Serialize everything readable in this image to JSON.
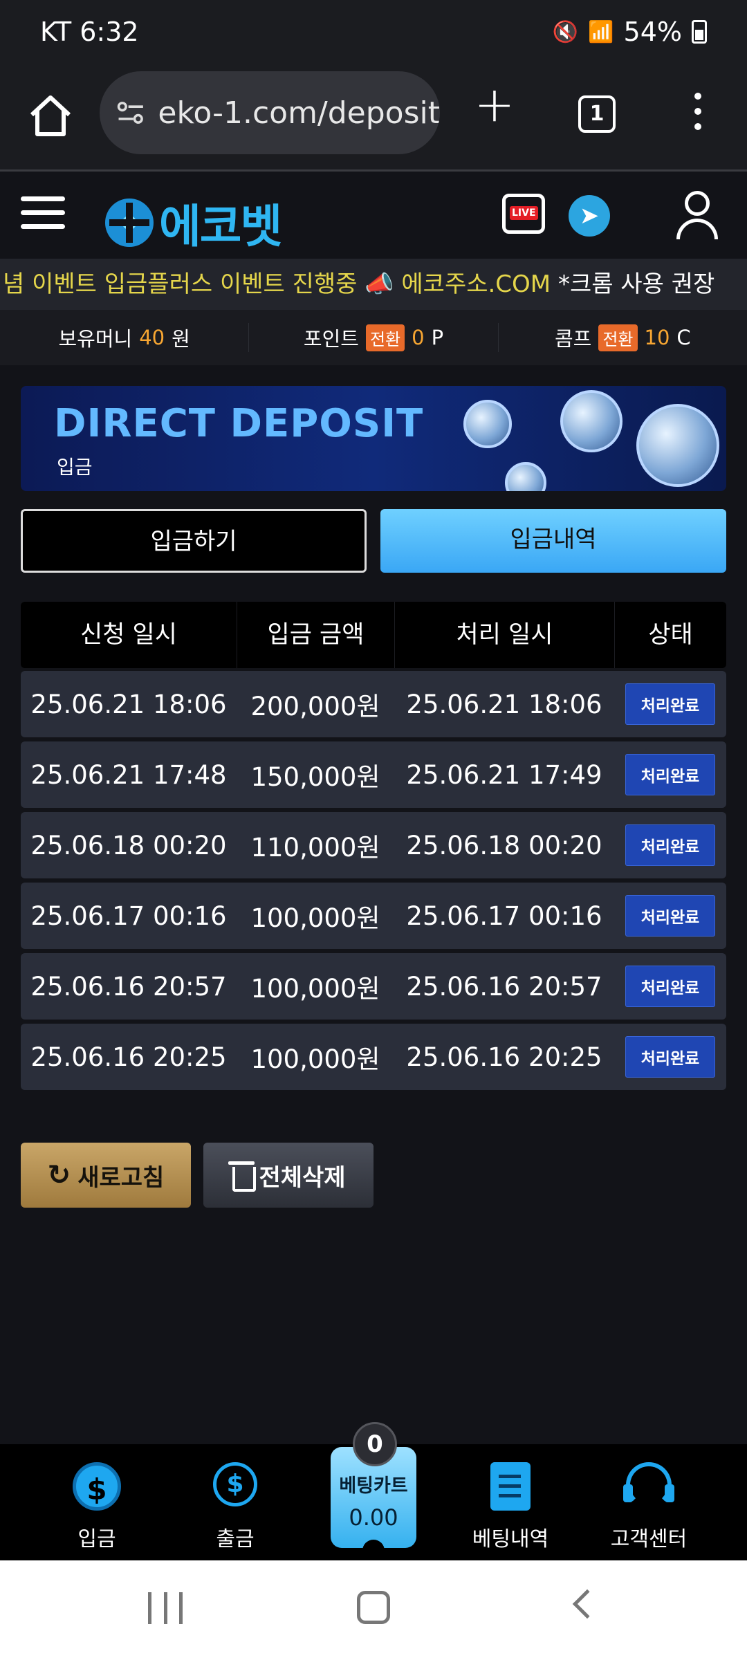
{
  "status_bar": {
    "carrier_time": "KT 6:32",
    "battery": "54%"
  },
  "browser": {
    "url": "eko-1.com/deposit",
    "tab_count": "1"
  },
  "site": {
    "logo_text": "에코벳"
  },
  "marquee": {
    "text": "념 이벤트 입금플러스 이벤트 진행중 📣 에코주소.COM",
    "tail": " *크롬 사용 권장"
  },
  "balances": {
    "money_label": "보유머니",
    "money_value": "40",
    "money_unit": "원",
    "point_label": "포인트",
    "point_convert": "전환",
    "point_value": "0",
    "point_unit": "P",
    "comp_label": "콤프",
    "comp_convert": "전환",
    "comp_value": "10",
    "comp_unit": "C"
  },
  "banner": {
    "title": "DIRECT DEPOSIT",
    "subtitle": "입금"
  },
  "tabs": {
    "deposit": "입금하기",
    "history": "입금내역"
  },
  "table": {
    "headers": [
      "신청 일시",
      "입금 금액",
      "처리 일시",
      "상태"
    ],
    "rows": [
      {
        "requested": "25.06.21 18:06",
        "amount": "200,000원",
        "processed": "25.06.21 18:06",
        "status": "처리완료"
      },
      {
        "requested": "25.06.21 17:48",
        "amount": "150,000원",
        "processed": "25.06.21 17:49",
        "status": "처리완료"
      },
      {
        "requested": "25.06.18 00:20",
        "amount": "110,000원",
        "processed": "25.06.18 00:20",
        "status": "처리완료"
      },
      {
        "requested": "25.06.17 00:16",
        "amount": "100,000원",
        "processed": "25.06.17 00:16",
        "status": "처리완료"
      },
      {
        "requested": "25.06.16 20:57",
        "amount": "100,000원",
        "processed": "25.06.16 20:57",
        "status": "처리완료"
      },
      {
        "requested": "25.06.16 20:25",
        "amount": "100,000원",
        "processed": "25.06.16 20:25",
        "status": "처리완료"
      }
    ]
  },
  "actions": {
    "refresh": "새로고침",
    "delete_all": "전체삭제"
  },
  "bottom_nav": {
    "deposit": "입금",
    "withdraw": "출금",
    "cart_label": "베팅카트",
    "cart_amount": "0.00",
    "cart_count": "0",
    "bet_history": "베팅내역",
    "support": "고객센터"
  },
  "colors": {
    "accent": "#3aa7f5",
    "status_badge": "#1f46b3",
    "highlight": "#f7a632"
  }
}
